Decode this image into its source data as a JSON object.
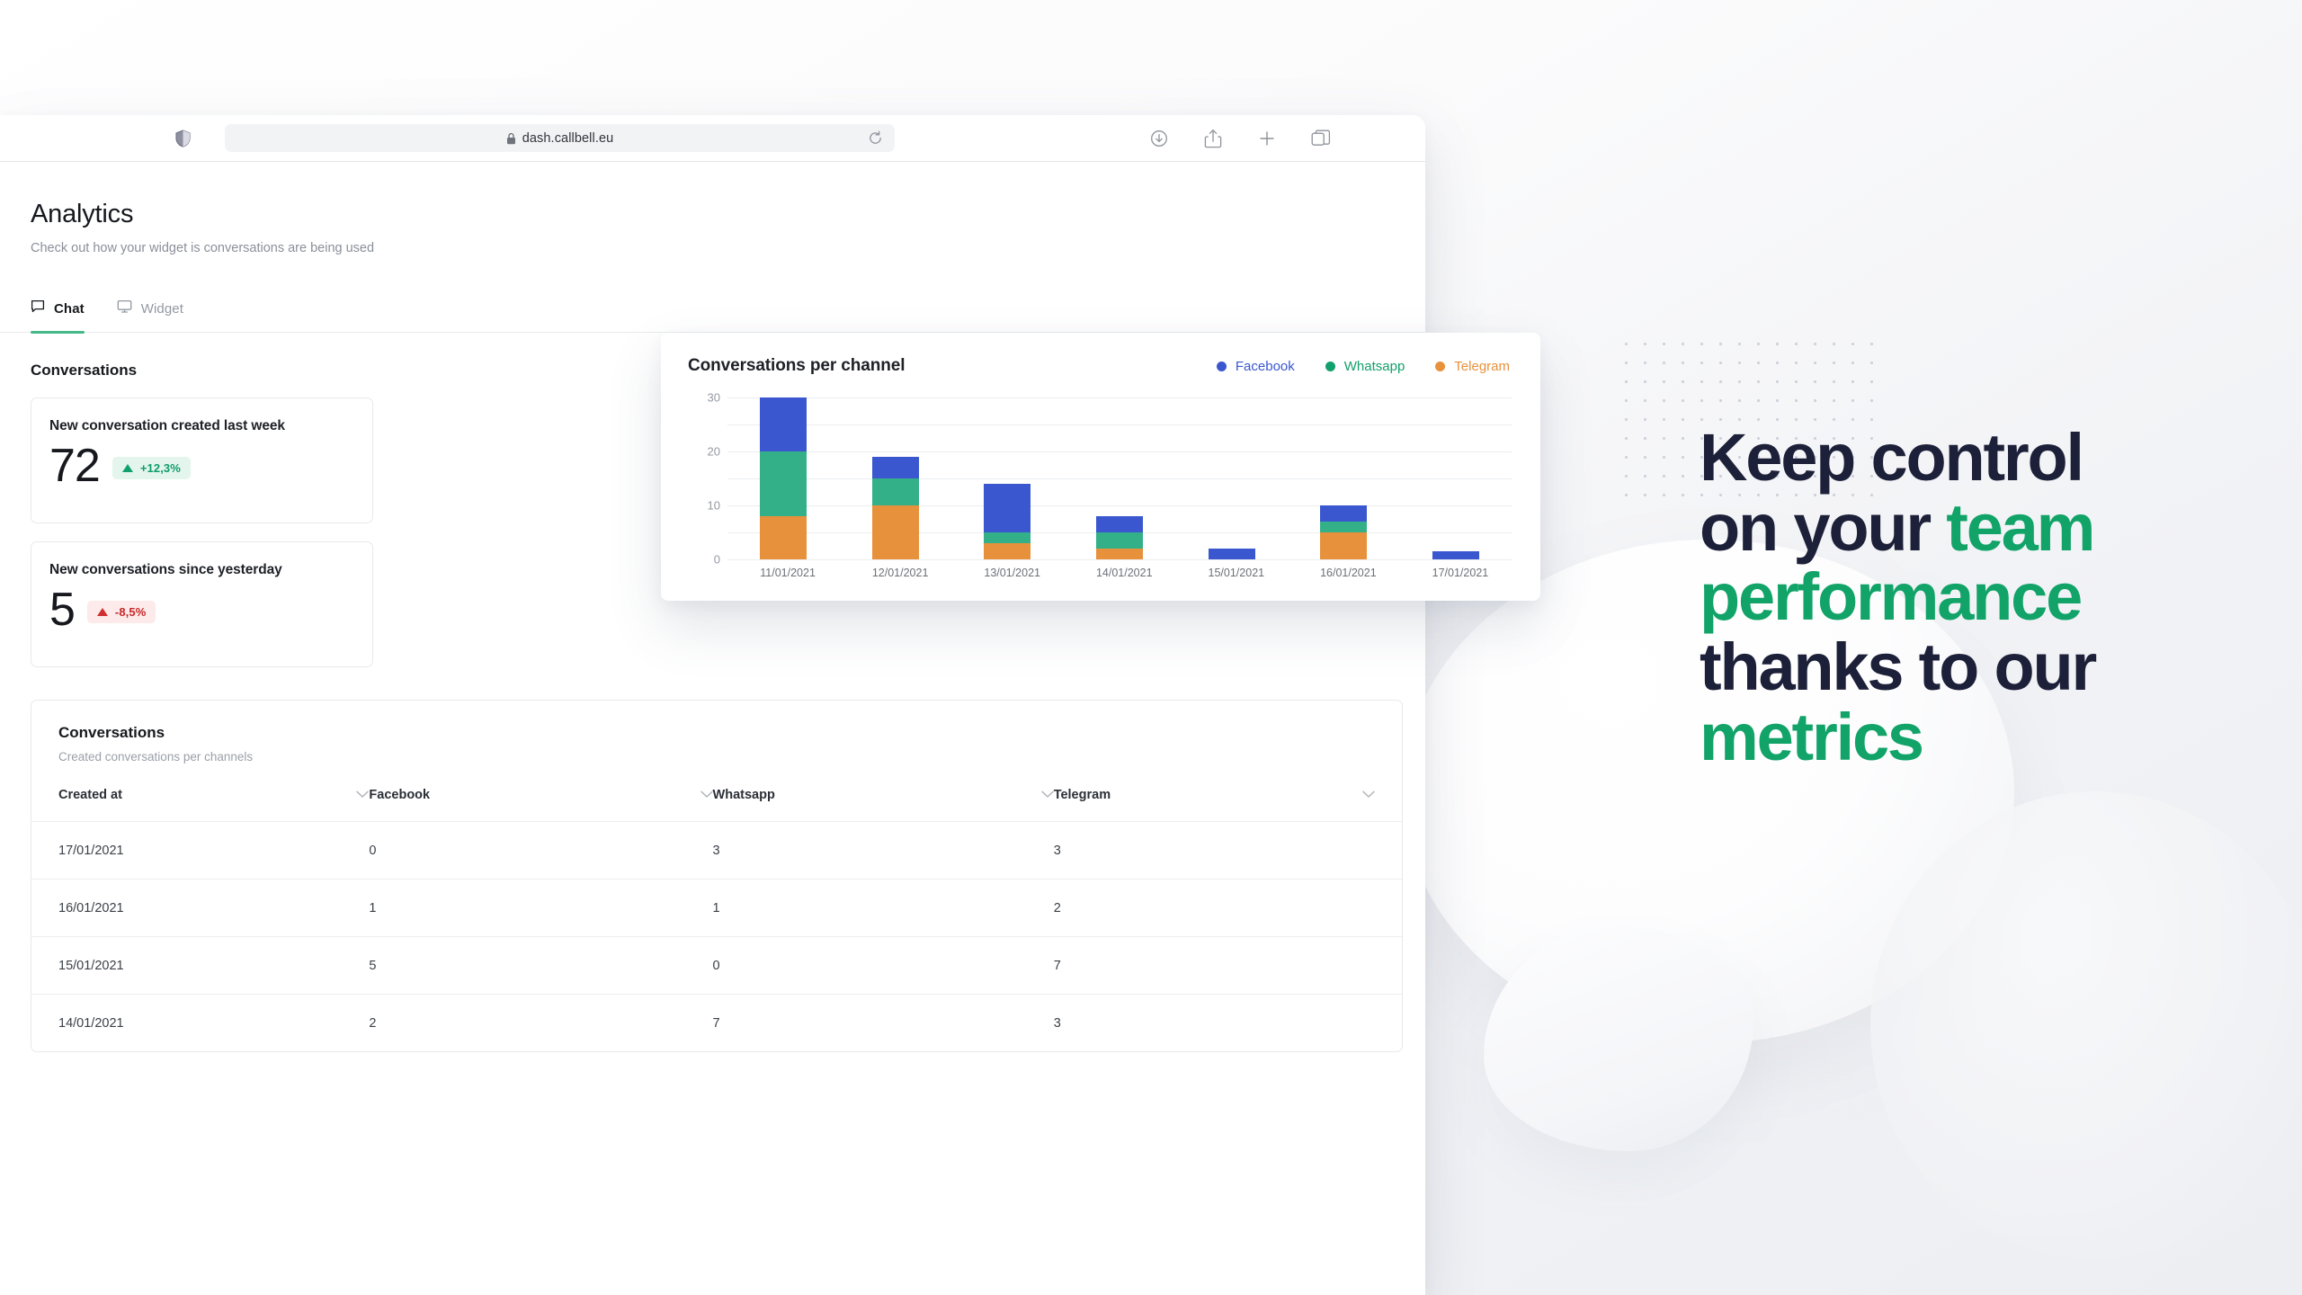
{
  "browser": {
    "sidebar_icon": "shield-icon",
    "url": "dash.callbell.eu",
    "lock_icon": "lock-icon",
    "reload_icon": "reload-icon",
    "toolbar_icons": [
      "download-icon",
      "share-icon",
      "new-tab-icon",
      "tab-overview-icon"
    ]
  },
  "page": {
    "title": "Analytics",
    "subtitle": "Check out how your widget is conversations are being used"
  },
  "tabs": [
    {
      "label": "Chat",
      "icon": "chat-bubble-icon",
      "active": true
    },
    {
      "label": "Widget",
      "icon": "monitor-icon",
      "active": false
    }
  ],
  "conversations_section": {
    "heading": "Conversations"
  },
  "metrics": [
    {
      "title": "New conversation created last week",
      "value": "72",
      "delta": "+12,3%",
      "direction": "up",
      "delta_color": "#0f9d6a",
      "delta_bg": "#e4f5ee"
    },
    {
      "title": "New conversations since yesterday",
      "value": "5",
      "delta": "-8,5%",
      "direction": "down",
      "delta_color": "#c62828",
      "delta_bg": "#fdeaea"
    }
  ],
  "table": {
    "title": "Conversations",
    "subtitle": "Created conversations per channels",
    "sort_icon": "chevron-down-icon",
    "columns": [
      "Created at",
      "Facebook",
      "Whatsapp",
      "Telegram"
    ],
    "rows": [
      [
        "17/01/2021",
        "0",
        "3",
        "3"
      ],
      [
        "16/01/2021",
        "1",
        "1",
        "2"
      ],
      [
        "15/01/2021",
        "5",
        "0",
        "7"
      ],
      [
        "14/01/2021",
        "2",
        "7",
        "3"
      ]
    ]
  },
  "chart_data": {
    "type": "bar",
    "stacked": true,
    "title": "Conversations per channel",
    "categories": [
      "11/01/2021",
      "12/01/2021",
      "13/01/2021",
      "14/01/2021",
      "15/01/2021",
      "16/01/2021",
      "17/01/2021"
    ],
    "series": [
      {
        "name": "Telegram",
        "color": "#e8913c",
        "values": [
          8,
          10,
          3,
          2,
          0,
          5,
          0
        ]
      },
      {
        "name": "Whatsapp",
        "color": "#33b088",
        "values": [
          12,
          5,
          2,
          3,
          0,
          2,
          0
        ]
      },
      {
        "name": "Facebook",
        "color": "#3a57cf",
        "values": [
          10,
          4,
          9,
          3,
          2,
          3,
          1.5
        ]
      }
    ],
    "stack_order": [
      "Telegram",
      "Whatsapp",
      "Facebook"
    ],
    "totals": [
      30,
      19,
      14,
      8,
      2,
      10,
      1.5
    ],
    "ylim": [
      0,
      30
    ],
    "yticks": [
      0,
      10,
      20,
      30
    ],
    "gridlines": [
      0,
      5,
      10,
      15,
      20,
      25,
      30
    ],
    "xlabel": "",
    "ylabel": "",
    "grid": true,
    "legend_position": "top-right",
    "legend": [
      {
        "name": "Facebook",
        "color": "#3a57cf"
      },
      {
        "name": "Whatsapp",
        "color": "#13a06c"
      },
      {
        "name": "Telegram",
        "color": "#e8913c"
      }
    ]
  },
  "marketing": {
    "line1_plain": "Keep control",
    "line2_plain": "on your ",
    "line2_hl": "team",
    "line3_hl": "performance",
    "line4_plain": "thanks to our",
    "line5_hl": "metrics",
    "accent_color": "#11a368",
    "text_color": "#1d2039"
  }
}
